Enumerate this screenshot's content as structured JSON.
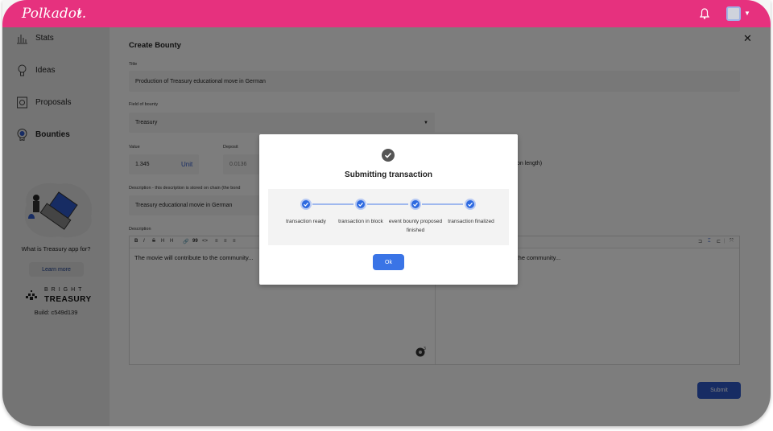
{
  "header": {
    "brand": "Polkadot.",
    "brand_color": "#e6317e",
    "icons": [
      "caret-down-icon",
      "bell-icon",
      "avatar",
      "caret-down-icon"
    ]
  },
  "sidebar": {
    "items": [
      {
        "label": "Stats",
        "icon": "stats-icon",
        "active": false
      },
      {
        "label": "Ideas",
        "icon": "lightbulb-icon",
        "active": false
      },
      {
        "label": "Proposals",
        "icon": "proposal-icon",
        "active": false
      },
      {
        "label": "Bounties",
        "icon": "bounty-medal-icon",
        "active": true
      }
    ],
    "promo_text": "What is Treasury app for?",
    "learn_more": "Learn more",
    "brand_small": "BRIGHT",
    "brand_big": "TREASURY",
    "build": "Build: c549d139"
  },
  "form": {
    "title": "Create Bounty",
    "title_label": "Title",
    "title_value": "Production of Treasury educational move in German",
    "field_label": "Field of bounty",
    "field_value": "Treasury",
    "value_label": "Value",
    "value_amount": "1.345",
    "value_unit": "Unit",
    "deposit_label": "Deposit",
    "deposit_value": "0.0136",
    "deposit_note": "iption length)",
    "description_short_label": "Description - this description is stored on chain (the bond",
    "description_short_value": "Treasury educational movie in German",
    "description_label": "Description",
    "editor_left_text": "The movie will contribute to the community...",
    "editor_right_text": "e to the community...",
    "toolbar_left": [
      "B",
      "I",
      "S",
      "H",
      "H",
      "🔗",
      "99",
      "<>",
      "≡",
      "≡",
      "≡"
    ],
    "toolbar_right": [
      "⊐",
      "⌶",
      "⊏",
      "|",
      "⤧"
    ],
    "submit": "Submit"
  },
  "modal": {
    "title": "Submitting transaction",
    "steps": [
      {
        "label": "transaction ready",
        "done": true
      },
      {
        "label": "transaction in block",
        "done": true
      },
      {
        "label": "event bounty proposed finished",
        "done": true
      },
      {
        "label": "transaction finalized",
        "done": true
      }
    ],
    "ok": "Ok",
    "accent": "#3a74e6"
  }
}
